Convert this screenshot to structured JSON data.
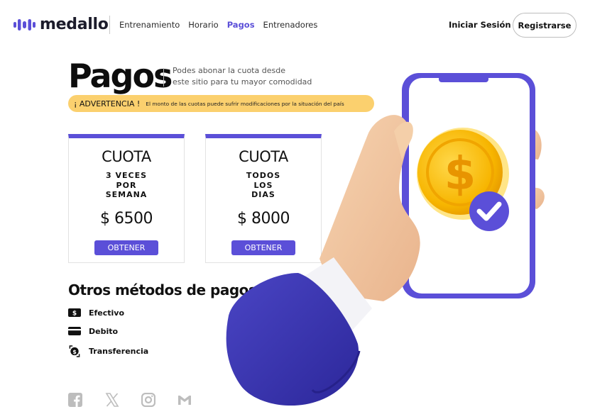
{
  "header": {
    "logo_text": "medallo",
    "nav": [
      "Entrenamiento",
      "Horario",
      "Pagos",
      "Entrenadores"
    ],
    "active_nav": "Pagos",
    "login": "Iniciar Sesión",
    "register": "Registrarse"
  },
  "hero": {
    "title": "Pagos",
    "subtitle_line1": "Podes abonar la cuota desde",
    "subtitle_line2": "este sitio para tu mayor comodidad",
    "warning_title": "¡ ADVERTENCIA !",
    "warning_text": "El monto de las cuotas puede sufrir modificaciones por la situación del país"
  },
  "plans": [
    {
      "title": "CUOTA",
      "freq": [
        "3 VECES",
        "POR",
        "SEMANA"
      ],
      "price": "$ 6500",
      "button": "OBTENER"
    },
    {
      "title": "CUOTA",
      "freq": [
        "TODOS",
        "LOS",
        "DIAS"
      ],
      "price": "$ 8000",
      "button": "OBTENER"
    }
  ],
  "methods": {
    "title": "Otros métodos de pagos",
    "items": [
      {
        "label": "Efectivo",
        "icon": "cash-icon"
      },
      {
        "label": "Debito",
        "icon": "credit-card-icon"
      },
      {
        "label": "Transferencia",
        "icon": "transfer-icon"
      }
    ]
  },
  "social": [
    "facebook-icon",
    "x-icon",
    "instagram-icon",
    "gmail-icon"
  ],
  "colors": {
    "accent": "#5b4fd8",
    "warning": "#fbd06e",
    "sleeve": "#3b36b0",
    "coin": "#f7b500"
  }
}
